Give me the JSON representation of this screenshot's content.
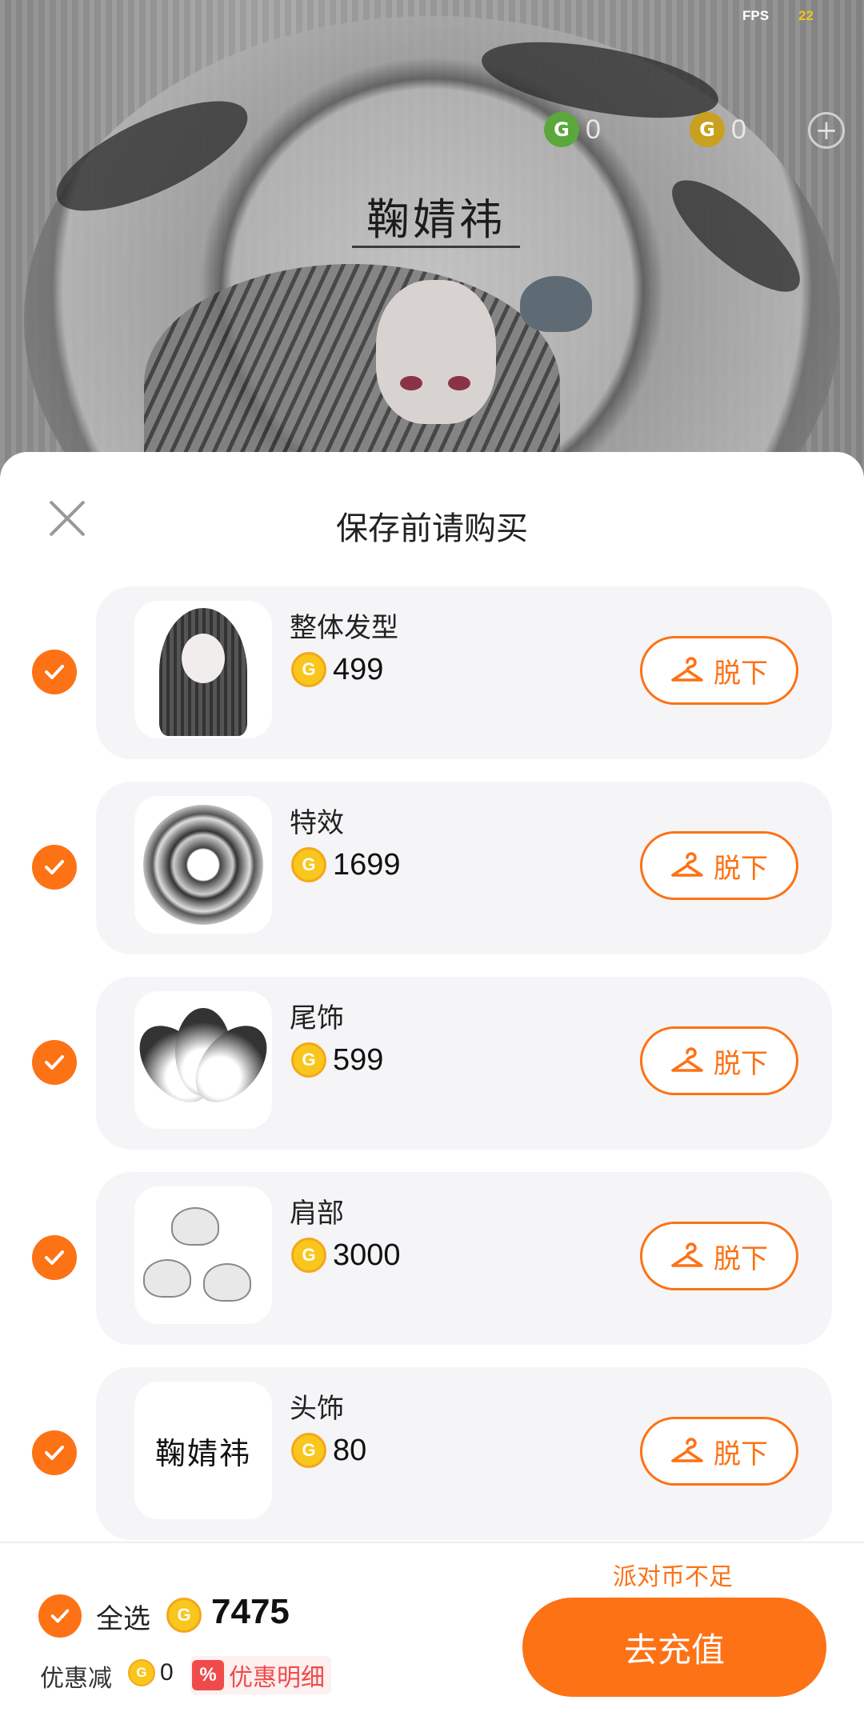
{
  "hud": {
    "fps_label": "FPS",
    "fps_value": "22",
    "green_coin_value": "0",
    "gold_coin_value": "0"
  },
  "scene": {
    "banner_text": "鞠婧祎"
  },
  "sheet": {
    "title": "保存前请购买",
    "remove_label": "脱下",
    "items": [
      {
        "name": "整体发型",
        "price": "499",
        "checked": true,
        "thumb_icon": "hairstyle"
      },
      {
        "name": "特效",
        "price": "1699",
        "checked": true,
        "thumb_icon": "effect-swirl"
      },
      {
        "name": "尾饰",
        "price": "599",
        "checked": true,
        "thumb_icon": "tail"
      },
      {
        "name": "肩部",
        "price": "3000",
        "checked": true,
        "thumb_icon": "shoulder-foxes"
      },
      {
        "name": "头饰",
        "price": "80",
        "checked": true,
        "thumb_text": "鞠婧祎"
      }
    ]
  },
  "footer": {
    "select_all_label": "全选",
    "total": "7475",
    "discount_label": "优惠减",
    "discount_value": "0",
    "discount_badge": "%",
    "discount_link": "优惠明细",
    "insufficient_text": "派对币不足",
    "recharge_label": "去充值"
  },
  "colors": {
    "accent": "#fc7215",
    "coin": "#f9c61d",
    "discount_red": "#f04b4b"
  }
}
